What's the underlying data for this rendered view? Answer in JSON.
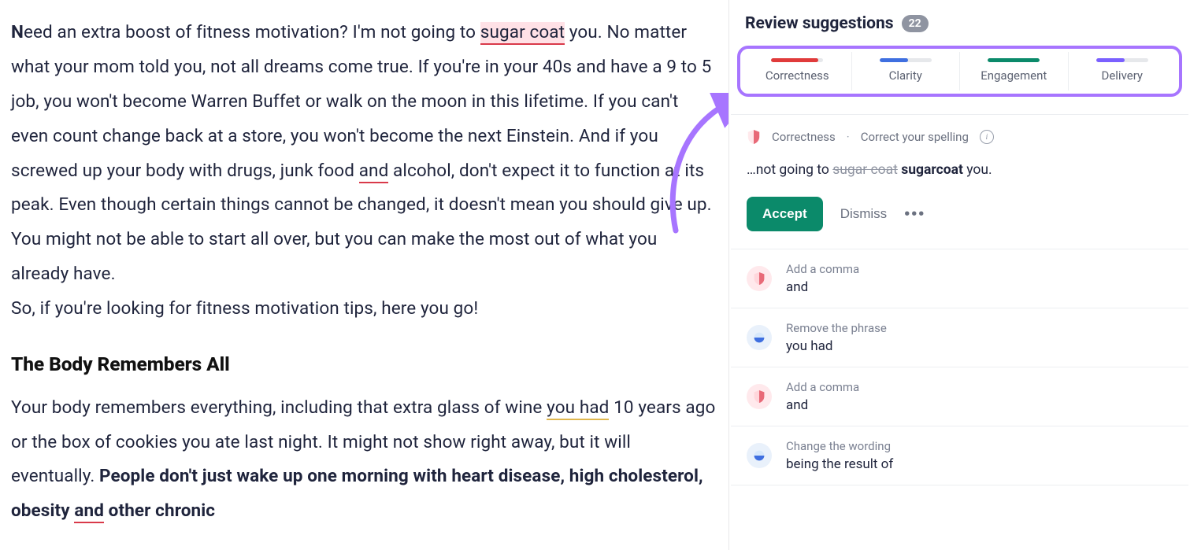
{
  "editor": {
    "para1": {
      "dropcap": "N",
      "seg1": "eed an extra boost of fitness motivation? I'm not going to ",
      "mark1": "sugar coat",
      "seg2": " you. No matter what your mom told you, not all dreams come true. If you're in your 40s and have a 9 to 5 job, you won't become Warren Buffet or walk on the moon in this lifetime. If you can't even count change back at a store, you won't become the next Einstein. And if you screwed up your body with drugs, junk food ",
      "mark2": "and",
      "seg3": " alcohol, don't expect it to function at its peak. Even though certain things cannot be changed, it doesn't mean you should give up. You might not be able to start all over, but you can make the most out of what you already have."
    },
    "para2": "So, if you're looking for fitness motivation tips, here you go!",
    "heading": "The Body Remembers All",
    "para3": {
      "seg1": "Your body remembers everything, including that extra glass of wine ",
      "mark1": "you had",
      "seg2": " 10 years ago or the box of cookies you ate last night. It might not show right away, but it will eventually. ",
      "bold1": "People don't just wake up one morning with heart disease, high cholesterol, obesity ",
      "bold_mark": "and",
      "bold2": " other chronic"
    }
  },
  "review": {
    "title": "Review suggestions",
    "count": "22",
    "tabs": [
      {
        "label": "Correctness",
        "color": "#e03b3b",
        "fill": 90
      },
      {
        "label": "Clarity",
        "color": "#3f6fe0",
        "fill": 55
      },
      {
        "label": "Engagement",
        "color": "#0b8a6a",
        "fill": 100
      },
      {
        "label": "Delivery",
        "color": "#7a60ff",
        "fill": 55
      }
    ],
    "primary": {
      "category": "Correctness",
      "rule": "Correct your spelling",
      "context_prefix": "…not going to ",
      "strike": "sugar coat",
      "replacement": "sugarcoat",
      "context_suffix": " you.",
      "accept": "Accept",
      "dismiss": "Dismiss"
    },
    "items": [
      {
        "icon": "shield-red",
        "title": "Add a comma",
        "word": "and"
      },
      {
        "icon": "circle-blue",
        "title": "Remove the phrase",
        "word": "you had"
      },
      {
        "icon": "shield-red",
        "title": "Add a comma",
        "word": "and"
      },
      {
        "icon": "circle-blue",
        "title": "Change the wording",
        "word": "being the result of"
      }
    ]
  }
}
